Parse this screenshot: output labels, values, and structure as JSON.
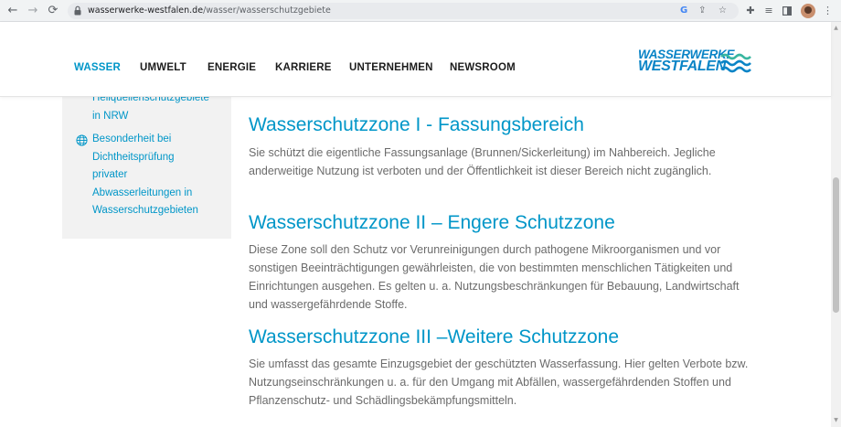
{
  "browser": {
    "url_host": "wasserwerke-westfalen.de",
    "url_path": "/wasser/wasserschutzgebiete",
    "icons": [
      "back-icon",
      "forward-icon",
      "reload-icon",
      "lock-icon",
      "google-icon",
      "share-icon",
      "bookmark-star-icon",
      "extensions-icon",
      "reading-list-icon",
      "side-panel-icon",
      "profile-avatar",
      "menu-icon"
    ]
  },
  "site": {
    "nav": [
      "WASSER",
      "UMWELT",
      "ENERGIE",
      "KARRIERE",
      "UNTERNEHMEN",
      "NEWSROOM"
    ],
    "active_nav": "WASSER",
    "logo_line1": "WASSERWERKE",
    "logo_line2": "WESTFALEN",
    "colors": {
      "accent": "#0096c8",
      "logo": "#0a84c6",
      "text": "#6b6b6b",
      "sidebar_bg": "#f2f2f2"
    }
  },
  "sidebar": {
    "items": [
      {
        "lines": [
          "Heilquellenschutzgebiete",
          "in NRW"
        ]
      },
      {
        "lines": [
          "Besonderheit bei",
          "Dichtheitsprüfung",
          "privater",
          "Abwasserleitungen in",
          "Wasserschutzgebieten"
        ]
      }
    ]
  },
  "article": {
    "sections": [
      {
        "title": "Wasserschutzzone I - Fassungsbereich",
        "text": "Sie schützt die eigentliche Fassungsanlage (Brunnen/Sickerleitung) im Nahbereich. Jegliche anderweitige Nutzung ist verboten und der Öffentlichkeit ist dieser Bereich nicht zugänglich."
      },
      {
        "title": "Wasserschutzzone II – Engere Schutzzone",
        "text": "Diese Zone soll den Schutz vor Verunreinigungen durch pathogene Mikroorganismen und vor sonstigen Beeinträchtigungen gewährleisten, die von bestimmten menschlichen Tätigkeiten und Einrichtungen ausgehen. Es gelten u. a. Nutzungsbeschränkungen für Bebauung, Landwirtschaft und wassergefährdende Stoffe."
      },
      {
        "title": "Wasserschutzzone III –Weitere Schutzzone",
        "text": "Sie umfasst das gesamte Einzugsgebiet der geschützten Wasserfassung. Hier gelten Verbote bzw. Nutzungseinschränkungen u. a. für den Umgang mit Abfällen, wassergefährdenden Stoffen und Pflanzenschutz- und Schädlingsbekämpfungsmitteln."
      }
    ]
  }
}
